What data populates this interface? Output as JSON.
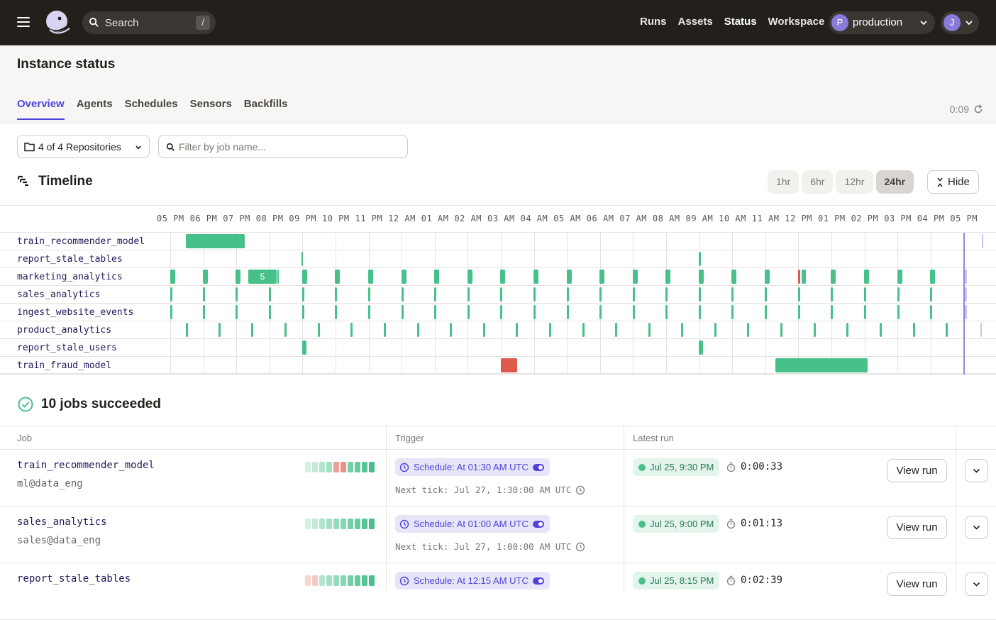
{
  "nav": {
    "search_label": "Search",
    "search_shortcut": "/",
    "links": [
      "Runs",
      "Assets",
      "Status",
      "Workspace"
    ],
    "active_link": "Status",
    "deployment": {
      "initial": "P",
      "name": "production"
    },
    "user": {
      "initial": "J"
    }
  },
  "header": {
    "title": "Instance status",
    "tabs": [
      "Overview",
      "Agents",
      "Schedules",
      "Sensors",
      "Backfills"
    ],
    "active_tab": "Overview",
    "refresh_countdown": "0:09"
  },
  "filters": {
    "repositories_label": "4 of 4 Repositories",
    "job_filter_placeholder": "Filter by job name..."
  },
  "timeline": {
    "title": "Timeline",
    "ranges": [
      "1hr",
      "6hr",
      "12hr",
      "24hr"
    ],
    "active_range": "24hr",
    "hide_label": "Hide",
    "ticks": [
      "05 PM",
      "06 PM",
      "07 PM",
      "08 PM",
      "09 PM",
      "10 PM",
      "11 PM",
      "12 AM",
      "01 AM",
      "02 AM",
      "03 AM",
      "04 AM",
      "05 AM",
      "06 AM",
      "07 AM",
      "08 AM",
      "09 AM",
      "10 AM",
      "11 AM",
      "12 PM",
      "01 PM",
      "02 PM",
      "03 PM",
      "04 PM",
      "05 PM"
    ],
    "rows": [
      {
        "name": "train_recommender_model"
      },
      {
        "name": "report_stale_tables"
      },
      {
        "name": "marketing_analytics",
        "cluster_count": "5"
      },
      {
        "name": "sales_analytics"
      },
      {
        "name": "ingest_website_events"
      },
      {
        "name": "product_analytics"
      },
      {
        "name": "report_stale_users"
      },
      {
        "name": "train_fraud_model"
      }
    ]
  },
  "jobs": {
    "summary": "10 jobs succeeded",
    "columns": [
      "Job",
      "Trigger",
      "Latest run"
    ],
    "view_run_label": "View run",
    "rows": [
      {
        "name": "train_recommender_model",
        "owner": "ml@data_eng",
        "schedule": "Schedule: At 01:30 AM UTC",
        "next_tick": "Next tick: Jul 27, 1:30:00 AM UTC",
        "latest_run": "Jul 25, 9:30 PM",
        "duration": "0:00:33",
        "history": [
          "s",
          "s",
          "s",
          "s",
          "f",
          "f",
          "s",
          "s",
          "s",
          "s"
        ]
      },
      {
        "name": "sales_analytics",
        "owner": "sales@data_eng",
        "schedule": "Schedule: At 01:00 AM UTC",
        "next_tick": "Next tick: Jul 27, 1:00:00 AM UTC",
        "latest_run": "Jul 25, 9:00 PM",
        "duration": "0:01:13",
        "history": [
          "s",
          "s",
          "s",
          "s",
          "s",
          "s",
          "s",
          "s",
          "s",
          "s"
        ]
      },
      {
        "name": "report_stale_tables",
        "owner": "",
        "schedule": "Schedule: At 12:15 AM UTC",
        "next_tick": "",
        "latest_run": "Jul 25, 8:15 PM",
        "duration": "0:02:39",
        "history": [
          "f",
          "f",
          "s",
          "s",
          "s",
          "s",
          "s",
          "s",
          "s",
          "s"
        ]
      }
    ]
  },
  "colors": {
    "accent": "#4f43dd",
    "success": "#48c08a",
    "failure": "#df5a4a",
    "nav_bg": "#231f1b"
  }
}
